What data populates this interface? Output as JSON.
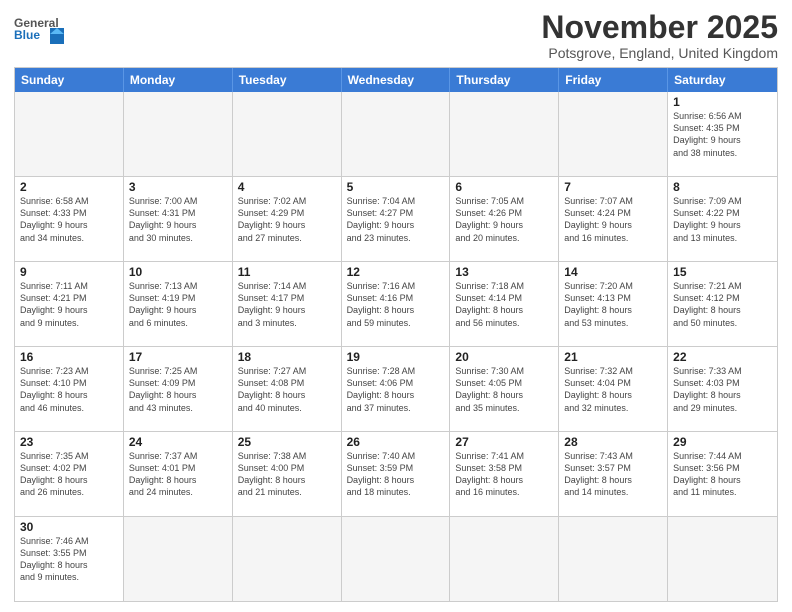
{
  "header": {
    "logo_general": "General",
    "logo_blue": "Blue",
    "month_title": "November 2025",
    "subtitle": "Potsgrove, England, United Kingdom"
  },
  "days_of_week": [
    "Sunday",
    "Monday",
    "Tuesday",
    "Wednesday",
    "Thursday",
    "Friday",
    "Saturday"
  ],
  "weeks": [
    [
      {
        "day": "",
        "info": ""
      },
      {
        "day": "",
        "info": ""
      },
      {
        "day": "",
        "info": ""
      },
      {
        "day": "",
        "info": ""
      },
      {
        "day": "",
        "info": ""
      },
      {
        "day": "",
        "info": ""
      },
      {
        "day": "1",
        "info": "Sunrise: 6:56 AM\nSunset: 4:35 PM\nDaylight: 9 hours\nand 38 minutes."
      }
    ],
    [
      {
        "day": "2",
        "info": "Sunrise: 6:58 AM\nSunset: 4:33 PM\nDaylight: 9 hours\nand 34 minutes."
      },
      {
        "day": "3",
        "info": "Sunrise: 7:00 AM\nSunset: 4:31 PM\nDaylight: 9 hours\nand 30 minutes."
      },
      {
        "day": "4",
        "info": "Sunrise: 7:02 AM\nSunset: 4:29 PM\nDaylight: 9 hours\nand 27 minutes."
      },
      {
        "day": "5",
        "info": "Sunrise: 7:04 AM\nSunset: 4:27 PM\nDaylight: 9 hours\nand 23 minutes."
      },
      {
        "day": "6",
        "info": "Sunrise: 7:05 AM\nSunset: 4:26 PM\nDaylight: 9 hours\nand 20 minutes."
      },
      {
        "day": "7",
        "info": "Sunrise: 7:07 AM\nSunset: 4:24 PM\nDaylight: 9 hours\nand 16 minutes."
      },
      {
        "day": "8",
        "info": "Sunrise: 7:09 AM\nSunset: 4:22 PM\nDaylight: 9 hours\nand 13 minutes."
      }
    ],
    [
      {
        "day": "9",
        "info": "Sunrise: 7:11 AM\nSunset: 4:21 PM\nDaylight: 9 hours\nand 9 minutes."
      },
      {
        "day": "10",
        "info": "Sunrise: 7:13 AM\nSunset: 4:19 PM\nDaylight: 9 hours\nand 6 minutes."
      },
      {
        "day": "11",
        "info": "Sunrise: 7:14 AM\nSunset: 4:17 PM\nDaylight: 9 hours\nand 3 minutes."
      },
      {
        "day": "12",
        "info": "Sunrise: 7:16 AM\nSunset: 4:16 PM\nDaylight: 8 hours\nand 59 minutes."
      },
      {
        "day": "13",
        "info": "Sunrise: 7:18 AM\nSunset: 4:14 PM\nDaylight: 8 hours\nand 56 minutes."
      },
      {
        "day": "14",
        "info": "Sunrise: 7:20 AM\nSunset: 4:13 PM\nDaylight: 8 hours\nand 53 minutes."
      },
      {
        "day": "15",
        "info": "Sunrise: 7:21 AM\nSunset: 4:12 PM\nDaylight: 8 hours\nand 50 minutes."
      }
    ],
    [
      {
        "day": "16",
        "info": "Sunrise: 7:23 AM\nSunset: 4:10 PM\nDaylight: 8 hours\nand 46 minutes."
      },
      {
        "day": "17",
        "info": "Sunrise: 7:25 AM\nSunset: 4:09 PM\nDaylight: 8 hours\nand 43 minutes."
      },
      {
        "day": "18",
        "info": "Sunrise: 7:27 AM\nSunset: 4:08 PM\nDaylight: 8 hours\nand 40 minutes."
      },
      {
        "day": "19",
        "info": "Sunrise: 7:28 AM\nSunset: 4:06 PM\nDaylight: 8 hours\nand 37 minutes."
      },
      {
        "day": "20",
        "info": "Sunrise: 7:30 AM\nSunset: 4:05 PM\nDaylight: 8 hours\nand 35 minutes."
      },
      {
        "day": "21",
        "info": "Sunrise: 7:32 AM\nSunset: 4:04 PM\nDaylight: 8 hours\nand 32 minutes."
      },
      {
        "day": "22",
        "info": "Sunrise: 7:33 AM\nSunset: 4:03 PM\nDaylight: 8 hours\nand 29 minutes."
      }
    ],
    [
      {
        "day": "23",
        "info": "Sunrise: 7:35 AM\nSunset: 4:02 PM\nDaylight: 8 hours\nand 26 minutes."
      },
      {
        "day": "24",
        "info": "Sunrise: 7:37 AM\nSunset: 4:01 PM\nDaylight: 8 hours\nand 24 minutes."
      },
      {
        "day": "25",
        "info": "Sunrise: 7:38 AM\nSunset: 4:00 PM\nDaylight: 8 hours\nand 21 minutes."
      },
      {
        "day": "26",
        "info": "Sunrise: 7:40 AM\nSunset: 3:59 PM\nDaylight: 8 hours\nand 18 minutes."
      },
      {
        "day": "27",
        "info": "Sunrise: 7:41 AM\nSunset: 3:58 PM\nDaylight: 8 hours\nand 16 minutes."
      },
      {
        "day": "28",
        "info": "Sunrise: 7:43 AM\nSunset: 3:57 PM\nDaylight: 8 hours\nand 14 minutes."
      },
      {
        "day": "29",
        "info": "Sunrise: 7:44 AM\nSunset: 3:56 PM\nDaylight: 8 hours\nand 11 minutes."
      }
    ],
    [
      {
        "day": "30",
        "info": "Sunrise: 7:46 AM\nSunset: 3:55 PM\nDaylight: 8 hours\nand 9 minutes."
      },
      {
        "day": "",
        "info": ""
      },
      {
        "day": "",
        "info": ""
      },
      {
        "day": "",
        "info": ""
      },
      {
        "day": "",
        "info": ""
      },
      {
        "day": "",
        "info": ""
      },
      {
        "day": "",
        "info": ""
      }
    ]
  ]
}
